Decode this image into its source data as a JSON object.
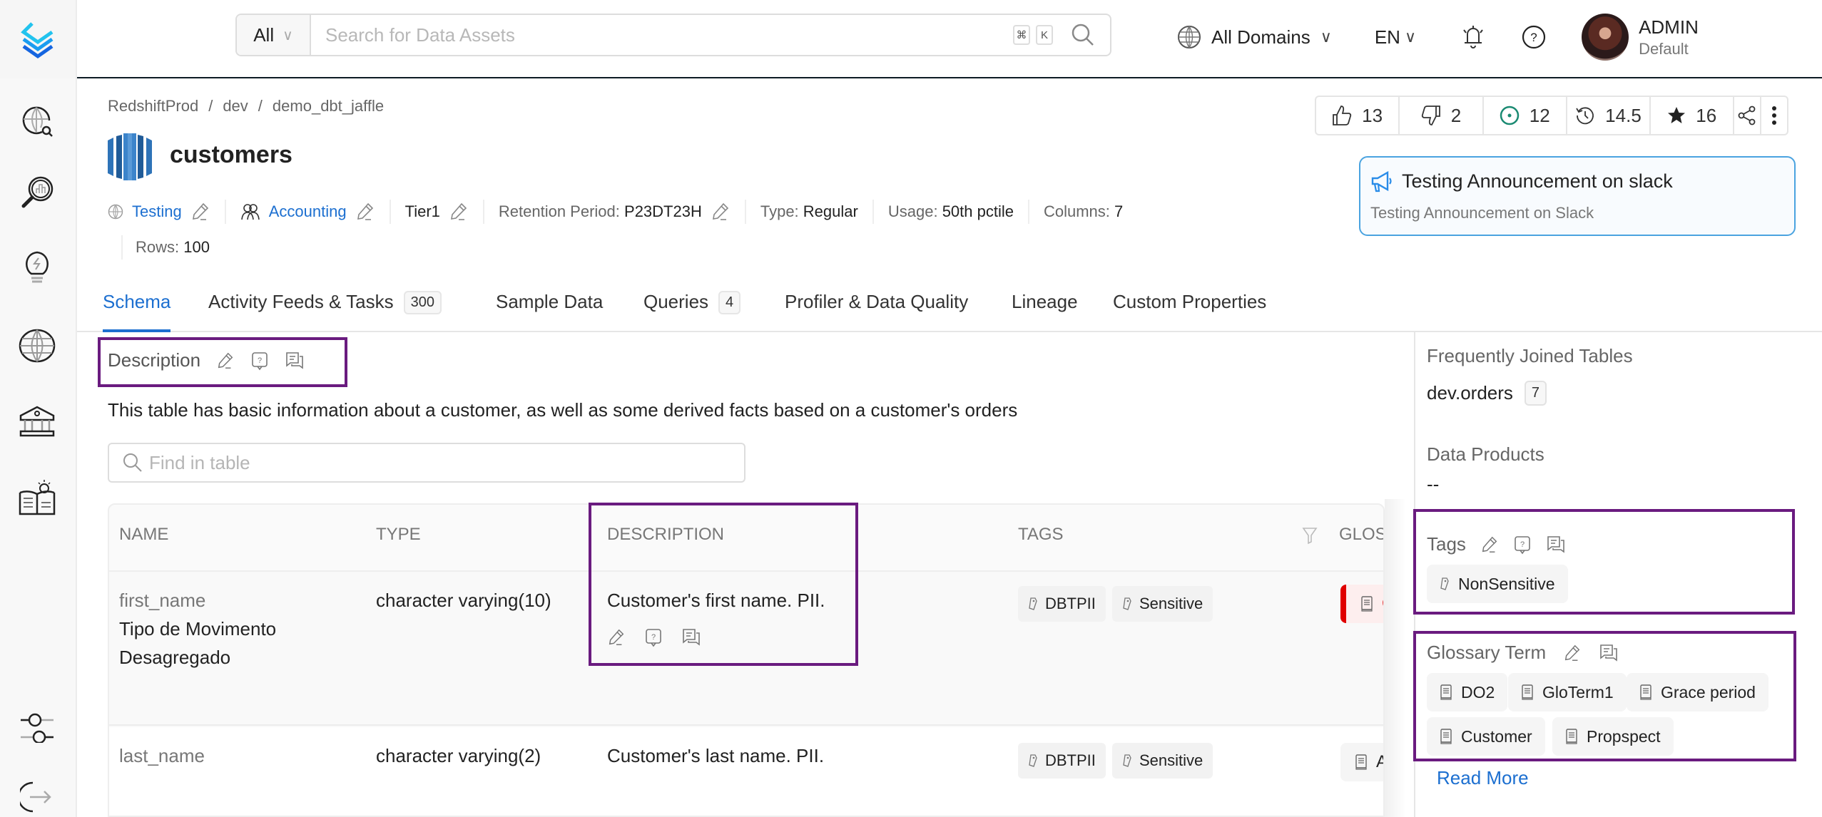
{
  "header": {
    "search_filter": "All",
    "search_placeholder": "Search for Data Assets",
    "shortcut_keys": [
      "⌘",
      "K"
    ],
    "domain_selector": "All Domains",
    "language": "EN",
    "user": {
      "name": "ADMIN",
      "role": "Default"
    }
  },
  "sidebar": {
    "items": [
      {
        "name": "explore",
        "icon": "globe-search-icon"
      },
      {
        "name": "observability",
        "icon": "magnifier-chart-icon"
      },
      {
        "name": "insights",
        "icon": "lightbulb-icon"
      },
      {
        "name": "domains",
        "icon": "globe-icon"
      },
      {
        "name": "governance",
        "icon": "bank-icon"
      },
      {
        "name": "knowledge",
        "icon": "book-idea-icon"
      },
      {
        "name": "settings",
        "icon": "sliders-icon"
      },
      {
        "name": "logout",
        "icon": "logout-icon"
      }
    ]
  },
  "breadcrumb": [
    "RedshiftProd",
    "dev",
    "demo_dbt_jaffle"
  ],
  "breadcrumb_separator": "/",
  "entity": {
    "title": "customers",
    "domain": "Testing",
    "owner": "Accounting",
    "tier": "Tier1",
    "retention_label": "Retention Period:",
    "retention_value": "P23DT23H",
    "type_label": "Type:",
    "type_value": "Regular",
    "usage_label": "Usage:",
    "usage_value": "50th pctile",
    "columns_label": "Columns:",
    "columns_value": "7",
    "rows_label": "Rows:",
    "rows_value": "100"
  },
  "stats": {
    "upvotes": "13",
    "downvotes": "2",
    "followers": "12",
    "version": "14.5",
    "stars": "16"
  },
  "announcement": {
    "title": "Testing Announcement on slack",
    "body": "Testing Announcement on Slack"
  },
  "tabs": [
    {
      "label": "Schema",
      "active": true
    },
    {
      "label": "Activity Feeds & Tasks",
      "count": "300"
    },
    {
      "label": "Sample Data"
    },
    {
      "label": "Queries",
      "count": "4"
    },
    {
      "label": "Profiler & Data Quality"
    },
    {
      "label": "Lineage"
    },
    {
      "label": "Custom Properties"
    }
  ],
  "description": {
    "heading": "Description",
    "text": "This table has basic information about a customer, as well as some derived facts based on a customer's orders"
  },
  "find_placeholder": "Find in table",
  "table": {
    "columns": [
      "NAME",
      "TYPE",
      "DESCRIPTION",
      "TAGS",
      "GLOS"
    ],
    "rows": [
      {
        "name": "first_name",
        "display_name": [
          "Tipo de Movimento",
          "Desagregado"
        ],
        "type": "character varying(10)",
        "description": "Customer's first name. PII.",
        "tags": [
          "DBTPII",
          "Sensitive"
        ],
        "glossary": "C"
      },
      {
        "name": "last_name",
        "type": "character varying(2)",
        "description": "Customer's last name. PII.",
        "tags": [
          "DBTPII",
          "Sensitive"
        ],
        "glossary": "Ac"
      }
    ]
  },
  "right_panel": {
    "joined_heading": "Frequently Joined Tables",
    "joined_table": "dev.orders",
    "joined_count": "7",
    "data_products_heading": "Data Products",
    "data_products_value": "--",
    "tags_heading": "Tags",
    "tags": [
      "NonSensitive"
    ],
    "glossary_heading": "Glossary Term",
    "glossary_terms": [
      "DO2",
      "GloTerm1",
      "Grace period",
      "Customer",
      "Propspect"
    ],
    "read_more": "Read More"
  },
  "colors": {
    "accent": "#1c6fd0",
    "highlight_box": "#6a1b7f",
    "glossary_alert": "#e00000",
    "announcement_border": "#4aa3e0"
  }
}
